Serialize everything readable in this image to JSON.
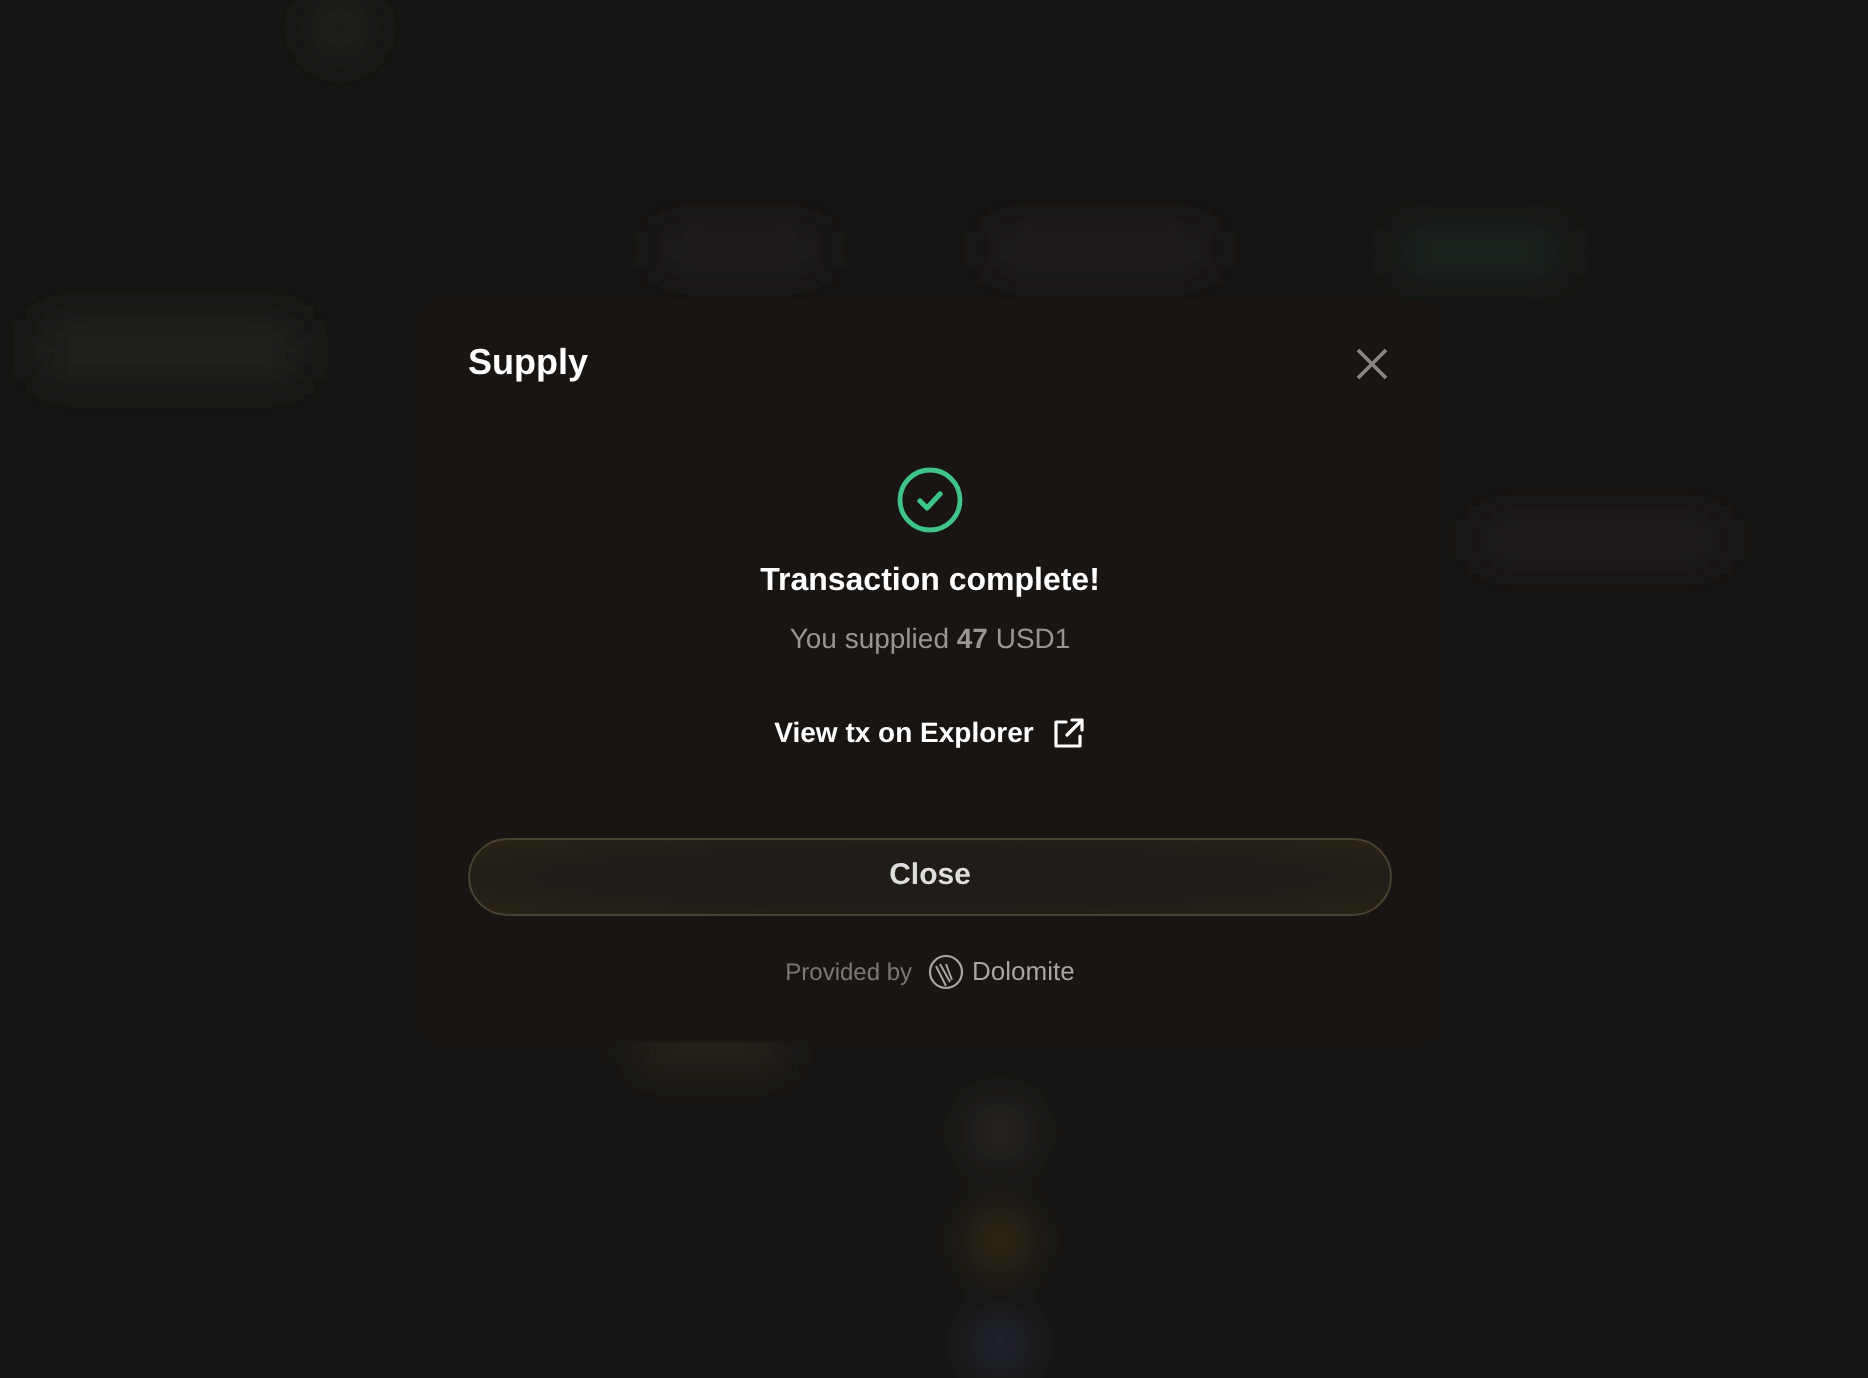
{
  "modal": {
    "title": "Supply",
    "status": "Transaction complete!",
    "message": "You supplied **47** USD1",
    "explorer_link": "View tx on Explorer",
    "close_button": "Close",
    "footer": {
      "prefix": "Provided by",
      "brand": "Dolomite"
    }
  }
}
